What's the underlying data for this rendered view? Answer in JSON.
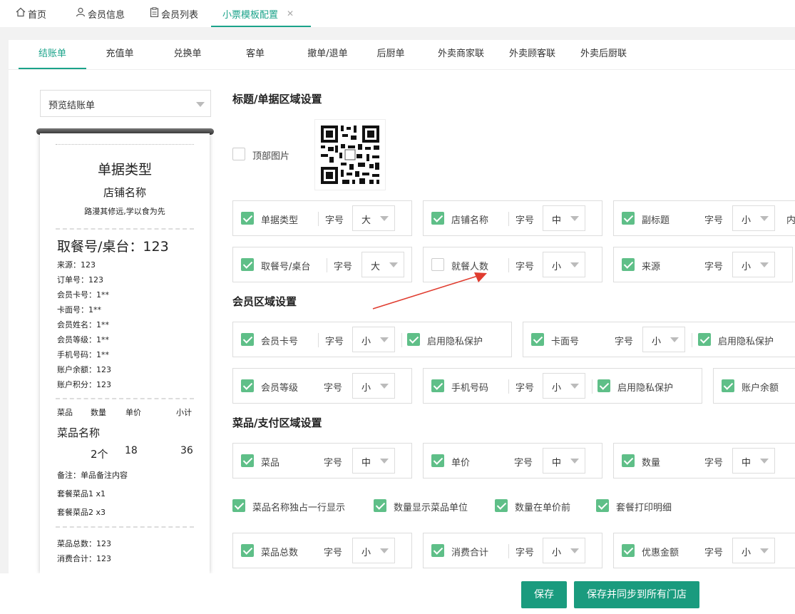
{
  "top_tabs": [
    {
      "label": "首页",
      "icon": "home-icon"
    },
    {
      "label": "会员信息",
      "icon": "user-icon"
    },
    {
      "label": "会员列表",
      "icon": "clipboard-icon"
    },
    {
      "label": "小票模板配置",
      "icon": "close-icon",
      "active": true
    }
  ],
  "sub_tabs": [
    "结账单",
    "充值单",
    "兑换单",
    "客单",
    "撤单/退单",
    "后厨单",
    "外卖商家联",
    "外卖顾客联",
    "外卖后厨联"
  ],
  "preview_select": {
    "value": "预览结账单"
  },
  "receipt": {
    "doc_type": "单据类型",
    "shop_name": "店铺名称",
    "subtitle": "路漫其修远,学以食为先",
    "pickup": "取餐号/桌台：123",
    "info_lines": [
      "来源：123",
      "订单号：123",
      "会员卡号：1**",
      "卡面号：1**",
      "会员姓名：1**",
      "会员等级：1**",
      "手机号码：1**",
      "账户余额：123",
      "账户积分：123"
    ],
    "col_headers": [
      "菜品",
      "数量",
      "单价",
      "小计"
    ],
    "item_name": "菜品名称",
    "item_qty": "2个",
    "item_price": "18",
    "item_subtotal": "36",
    "remark": "备注：单品备注内容",
    "combo_lines": [
      "套餐菜品1 x1",
      "套餐菜品2 x3"
    ],
    "totals": [
      "菜品总数：123",
      "消费合计：123"
    ]
  },
  "sections": {
    "title_area": "标题/单据区域设置",
    "member_area": "会员区域设置",
    "dish_area": "菜品/支付区域设置"
  },
  "top_image": {
    "label": "顶部图片",
    "checked": false,
    "image": "qr-code-icon"
  },
  "font_label": "字号",
  "title_rows": [
    [
      {
        "label": "单据类型",
        "checked": true,
        "size": "大"
      },
      {
        "label": "店铺名称",
        "checked": true,
        "size": "中"
      },
      {
        "label": "副标题",
        "checked": true,
        "size": "小",
        "extra": "内"
      }
    ],
    [
      {
        "label": "取餐号/桌台",
        "checked": true,
        "size": "大"
      },
      {
        "label": "就餐人数",
        "checked": false,
        "size": "小"
      },
      {
        "label": "来源",
        "checked": true,
        "size": "小"
      }
    ]
  ],
  "member_rows": [
    [
      {
        "label": "会员卡号",
        "checked": true,
        "size": "小",
        "privacy_label": "启用隐私保护",
        "privacy": true
      },
      {
        "label": "卡面号",
        "checked": true,
        "size": "小",
        "privacy_label": "启用隐私保护",
        "privacy": true
      }
    ],
    [
      {
        "label": "会员等级",
        "checked": true,
        "size": "小"
      },
      {
        "label": "手机号码",
        "checked": true,
        "size": "小",
        "privacy_label": "启用隐私保护",
        "privacy": true
      },
      {
        "label": "账户余额",
        "checked": true
      }
    ]
  ],
  "dish_row1": [
    {
      "label": "菜品",
      "checked": true,
      "size": "中"
    },
    {
      "label": "单价",
      "checked": true,
      "size": "中"
    },
    {
      "label": "数量",
      "checked": true,
      "size": "中"
    }
  ],
  "dish_options": [
    {
      "label": "菜品名称独占一行显示",
      "checked": true
    },
    {
      "label": "数量显示菜品单位",
      "checked": true
    },
    {
      "label": "数量在单价前",
      "checked": true
    },
    {
      "label": "套餐打印明细",
      "checked": true
    }
  ],
  "dish_row2": [
    {
      "label": "菜品总数",
      "checked": true,
      "size": "小"
    },
    {
      "label": "消费合计",
      "checked": true,
      "size": "小"
    },
    {
      "label": "优惠金额",
      "checked": true,
      "size": "小"
    }
  ],
  "buttons": {
    "save": "保存",
    "save_sync": "保存并同步到所有门店"
  },
  "colors": {
    "accent": "#1aa38a",
    "checkbox": "#5fbf88",
    "arrow": "#e03c2f"
  }
}
